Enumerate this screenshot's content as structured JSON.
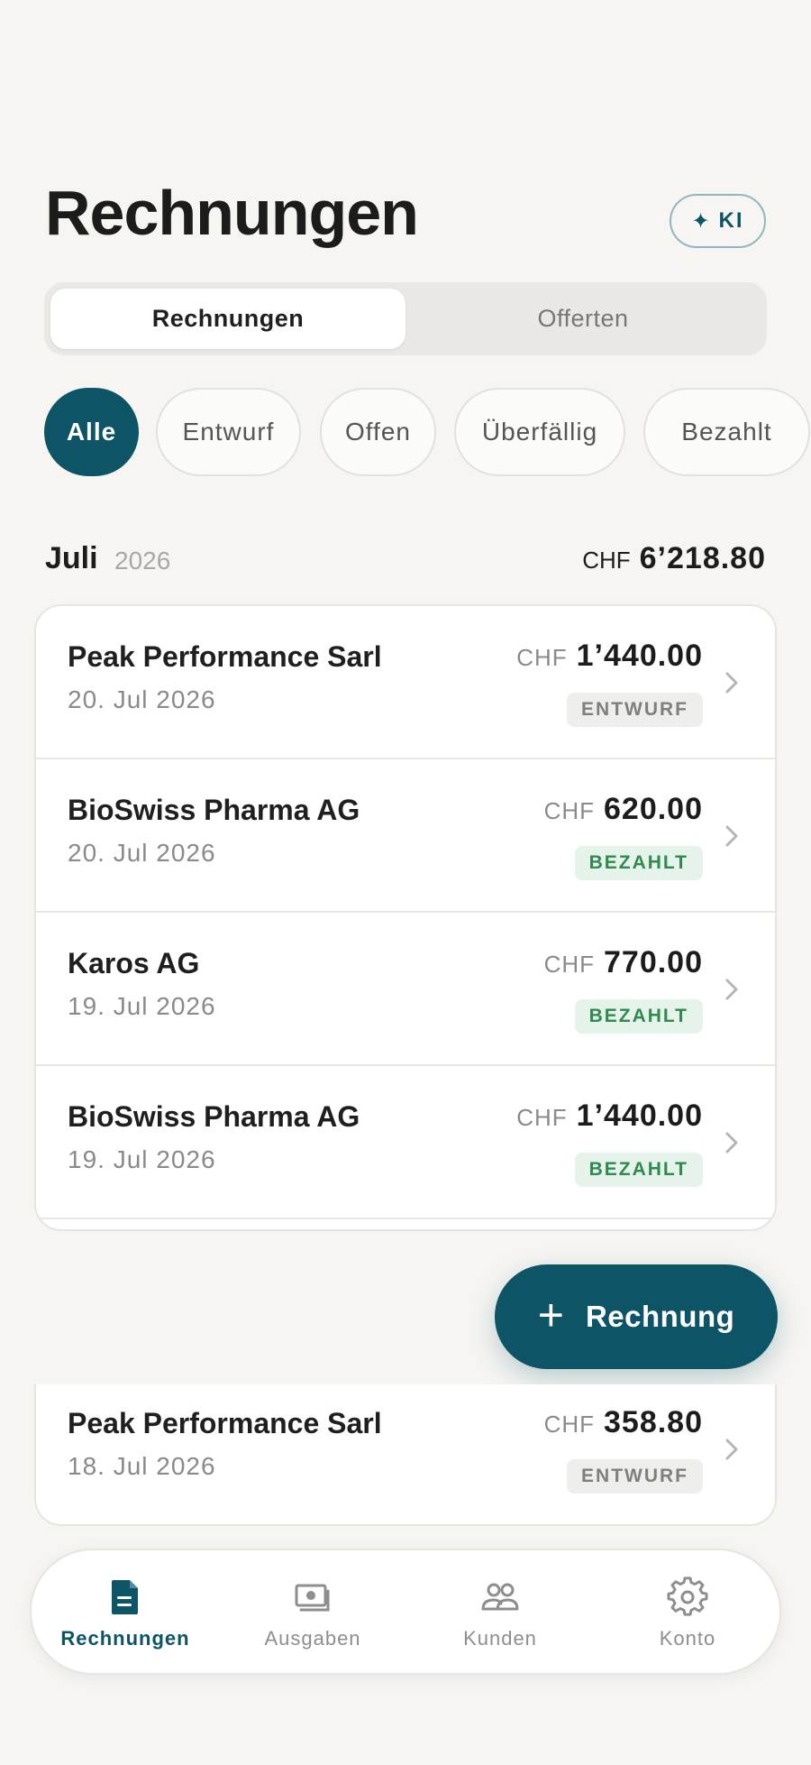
{
  "header": {
    "title": "Rechnungen",
    "ki_label": "KI"
  },
  "segments": [
    {
      "label": "Rechnungen",
      "active": true
    },
    {
      "label": "Offerten",
      "active": false
    }
  ],
  "filters": [
    {
      "label": "Alle",
      "active": true
    },
    {
      "label": "Entwurf",
      "active": false
    },
    {
      "label": "Offen",
      "active": false
    },
    {
      "label": "Überfällig",
      "active": false
    },
    {
      "label": "Bezahlt",
      "active": false
    }
  ],
  "section": {
    "month": "Juli",
    "year": "2026",
    "currency": "CHF",
    "total": "6’218.80"
  },
  "invoices": [
    {
      "client": "Peak Performance Sarl",
      "date": "20. Jul 2026",
      "currency": "CHF",
      "amount": "1’440.00",
      "status": "ENTWURF"
    },
    {
      "client": "BioSwiss Pharma AG",
      "date": "20. Jul 2026",
      "currency": "CHF",
      "amount": "620.00",
      "status": "BEZAHLT"
    },
    {
      "client": "Karos AG",
      "date": "19. Jul 2026",
      "currency": "CHF",
      "amount": "770.00",
      "status": "BEZAHLT"
    },
    {
      "client": "BioSwiss Pharma AG",
      "date": "19. Jul 2026",
      "currency": "CHF",
      "amount": "1’440.00",
      "status": "BEZAHLT"
    },
    {
      "client": "Peak Performance Sarl",
      "date": "18. Jul 2026",
      "currency": "CHF",
      "amount": "358.80",
      "status": "ENTWURF"
    }
  ],
  "fab": {
    "label": "Rechnung"
  },
  "bottom_nav": [
    {
      "label": "Rechnungen",
      "icon": "document-icon",
      "active": true
    },
    {
      "label": "Ausgaben",
      "icon": "cash-icon",
      "active": false
    },
    {
      "label": "Kunden",
      "icon": "people-icon",
      "active": false
    },
    {
      "label": "Konto",
      "icon": "gear-icon",
      "active": false
    }
  ],
  "colors": {
    "accent": "#0d5566",
    "background": "#f6f5f2",
    "paid_badge_text": "#2f8a4f",
    "paid_badge_bg": "#e5f3ea",
    "draft_badge_text": "#7f7f7f",
    "draft_badge_bg": "#eeeeec"
  }
}
